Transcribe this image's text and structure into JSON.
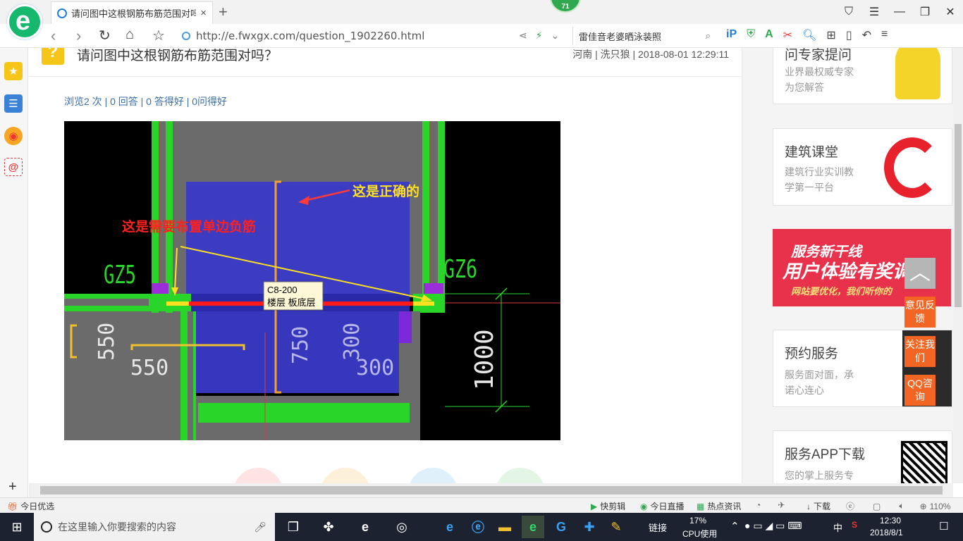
{
  "browser": {
    "tab_title": "请问图中这根钢筋布筋范围对吗",
    "tab_close": "×",
    "new_tab": "+",
    "badge": "71",
    "url": "http://e.fwxgx.com/question_1902260.html",
    "search_text": "雷佳音老婆晒泳装照"
  },
  "question": {
    "title": "请问图中这根钢筋布筋范围对吗？",
    "meta": "河南 | 洗只狼 | 2018-08-01 12:29:11",
    "stats": "浏览2 次 | 0 回答 | 0 答得好 | 0问得好"
  },
  "cad": {
    "annotation_correct": "这是正确的",
    "annotation_needed": "这是需要布置单边负筋",
    "label_gz5": "GZ5",
    "label_gz6": "GZ6",
    "tooltip_line1": "C8-200",
    "tooltip_line2": "楼层 板底层",
    "dim_550_v": "550",
    "dim_550_h": "550",
    "dim_750": "750",
    "dim_300_a": "300",
    "dim_300_b": "300",
    "dim_1000": "1000"
  },
  "right": {
    "card1_title": "问专家提问",
    "card1_desc1": "业界最权威专家",
    "card1_desc2": "为您解答",
    "card2_title": "建筑课堂",
    "card2_desc1": "建筑行业实训教",
    "card2_desc2": "学第一平台",
    "banner_line1": "服务新干线",
    "banner_line2": "用户体验有奖调研",
    "banner_line3": "网站要优化，我们听你的",
    "card3_title": "预约服务",
    "card3_desc1": "服务面对面，承",
    "card3_desc2": "诺心连心",
    "card4_title": "服务APP下载",
    "card4_desc1": "您的掌上服务专"
  },
  "float": {
    "to_top": "︿",
    "feedback": "意见反馈",
    "follow": "关注我们",
    "qq": "QQ咨询"
  },
  "statusbar": {
    "today_pick": "今日优选",
    "quick_clip": "快剪辑",
    "today_live": "今日直播",
    "hot_news": "热点资讯",
    "download": "下载",
    "zoom": "110%"
  },
  "taskbar": {
    "search_placeholder": "在这里输入你要搜索的内容",
    "link_label": "链接",
    "cpu_percent": "17%",
    "cpu_label": "CPU使用",
    "ime": "中",
    "time": "12:30",
    "date": "2018/8/1"
  },
  "colors": {
    "accent_green": "#16b86e",
    "link_blue": "#3a6ea8",
    "float_orange": "#f26522",
    "banner_red": "#e8324c"
  }
}
